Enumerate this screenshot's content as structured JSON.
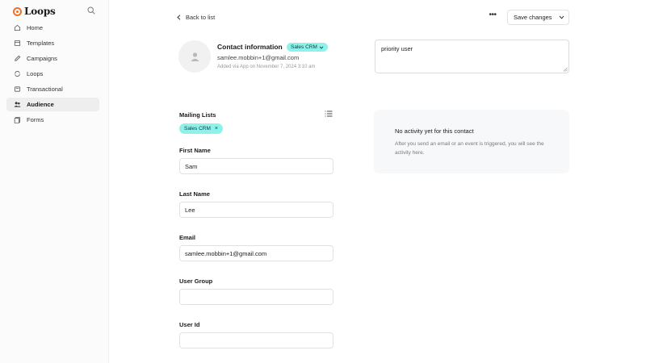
{
  "app": {
    "name": "Loops"
  },
  "sidebar": {
    "items": [
      {
        "label": "Home",
        "icon": "home-icon"
      },
      {
        "label": "Templates",
        "icon": "templates-icon"
      },
      {
        "label": "Campaigns",
        "icon": "campaigns-icon"
      },
      {
        "label": "Loops",
        "icon": "loops-icon"
      },
      {
        "label": "Transactional",
        "icon": "transactional-icon"
      },
      {
        "label": "Audience",
        "icon": "audience-icon",
        "active": true
      },
      {
        "label": "Forms",
        "icon": "forms-icon"
      }
    ]
  },
  "topbar": {
    "back_label": "Back to list",
    "more_label": "•••",
    "save_label": "Save changes"
  },
  "contact": {
    "title": "Contact information",
    "crm_badge": "Sales CRM",
    "email": "samlee.mobbin+1@gmail.com",
    "added": "Added via App on November 7, 2024 3:10 am"
  },
  "notes": {
    "value": "priority user"
  },
  "mailing_lists": {
    "label": "Mailing Lists",
    "tags": [
      {
        "label": "Sales CRM",
        "remove": "×"
      }
    ]
  },
  "fields": {
    "first_name": {
      "label": "First Name",
      "value": "Sam"
    },
    "last_name": {
      "label": "Last Name",
      "value": "Lee"
    },
    "email": {
      "label": "Email",
      "value": "samlee.mobbin+1@gmail.com"
    },
    "user_group": {
      "label": "User Group",
      "value": ""
    },
    "user_id": {
      "label": "User Id",
      "value": ""
    }
  },
  "activity": {
    "title": "No activity yet for this contact",
    "description": "After you send an email or an event is triggered, you will see the activity here."
  },
  "colors": {
    "brand": "#e8742d",
    "tag_bg": "#8ef2ec",
    "active_nav": "#eeeeee",
    "activity_bg": "#f7f8fa"
  }
}
